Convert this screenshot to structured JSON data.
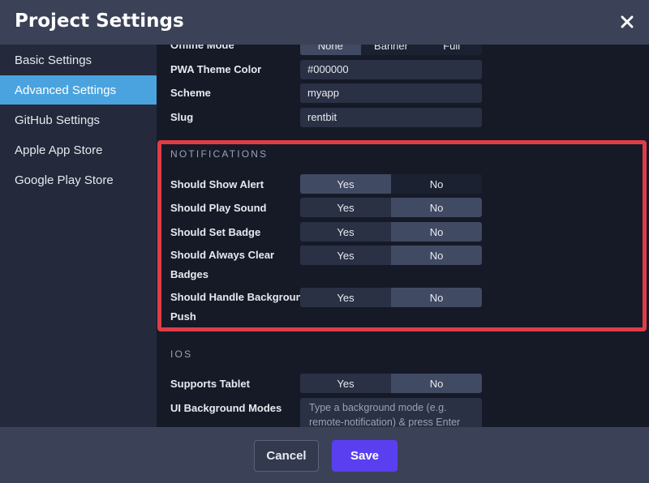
{
  "dialog": {
    "title": "Project Settings"
  },
  "sidebar": {
    "items": [
      {
        "label": "Basic Settings"
      },
      {
        "label": "Advanced Settings",
        "active": true
      },
      {
        "label": "GitHub Settings"
      },
      {
        "label": "Apple App Store"
      },
      {
        "label": "Google Play Store"
      }
    ]
  },
  "general": {
    "offline_mode": {
      "label": "Offline Mode",
      "options": [
        "None",
        "Banner",
        "Full"
      ]
    },
    "pwa_theme_color": {
      "label": "PWA Theme Color",
      "value": "#000000"
    },
    "scheme": {
      "label": "Scheme",
      "value": "myapp"
    },
    "slug": {
      "label": "Slug",
      "value": "rentbit"
    }
  },
  "notifications": {
    "title": "NOTIFICATIONS",
    "rows": [
      {
        "label": "Should Show Alert",
        "yes": "Yes",
        "no": "No",
        "selected": "Yes"
      },
      {
        "label": "Should Play Sound",
        "yes": "Yes",
        "no": "No",
        "selected": "No"
      },
      {
        "label": "Should Set Badge",
        "yes": "Yes",
        "no": "No",
        "selected": "No"
      },
      {
        "label_line1": "Should Always Clear",
        "label_line2": "Badges",
        "yes": "Yes",
        "no": "No",
        "selected": "No"
      },
      {
        "label_line1": "Should Handle Background",
        "label_line2": "Push",
        "yes": "Yes",
        "no": "No",
        "selected": "No"
      }
    ]
  },
  "ios": {
    "title": "IOS",
    "supports_tablet": {
      "label": "Supports Tablet",
      "yes": "Yes",
      "no": "No",
      "selected": "No"
    },
    "ui_background_modes": {
      "label": "UI Background Modes",
      "placeholder": "Type a background mode (e.g. remote-notification) & press Enter"
    }
  },
  "footer": {
    "cancel_label": "Cancel",
    "save_label": "Save"
  },
  "colors": {
    "accent": "#4aa3df",
    "save_button": "#5a3ff1",
    "highlight_border": "#e03c47"
  }
}
